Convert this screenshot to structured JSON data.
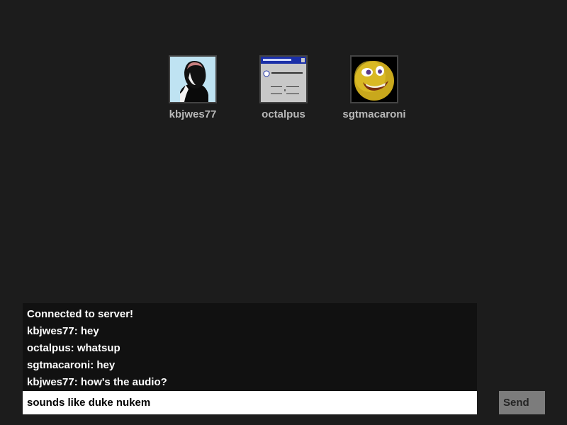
{
  "users": [
    {
      "username": "kbjwes77",
      "avatar_icon": "portrait-photo"
    },
    {
      "username": "octalpus",
      "avatar_icon": "dialog-window-screenshot"
    },
    {
      "username": "sgtmacaroni",
      "avatar_icon": "yellow-smiley-face"
    }
  ],
  "chat": {
    "messages": [
      "Connected to server!",
      "kbjwes77: hey",
      "octalpus: whatsup",
      "sgtmacaroni: hey",
      "kbjwes77: how's the audio?"
    ],
    "input_value": "sounds like duke nukem",
    "send_label": "Send"
  },
  "colors": {
    "background": "#1c1c1c",
    "log_background": "#111111",
    "send_button": "#7c7c7c"
  }
}
